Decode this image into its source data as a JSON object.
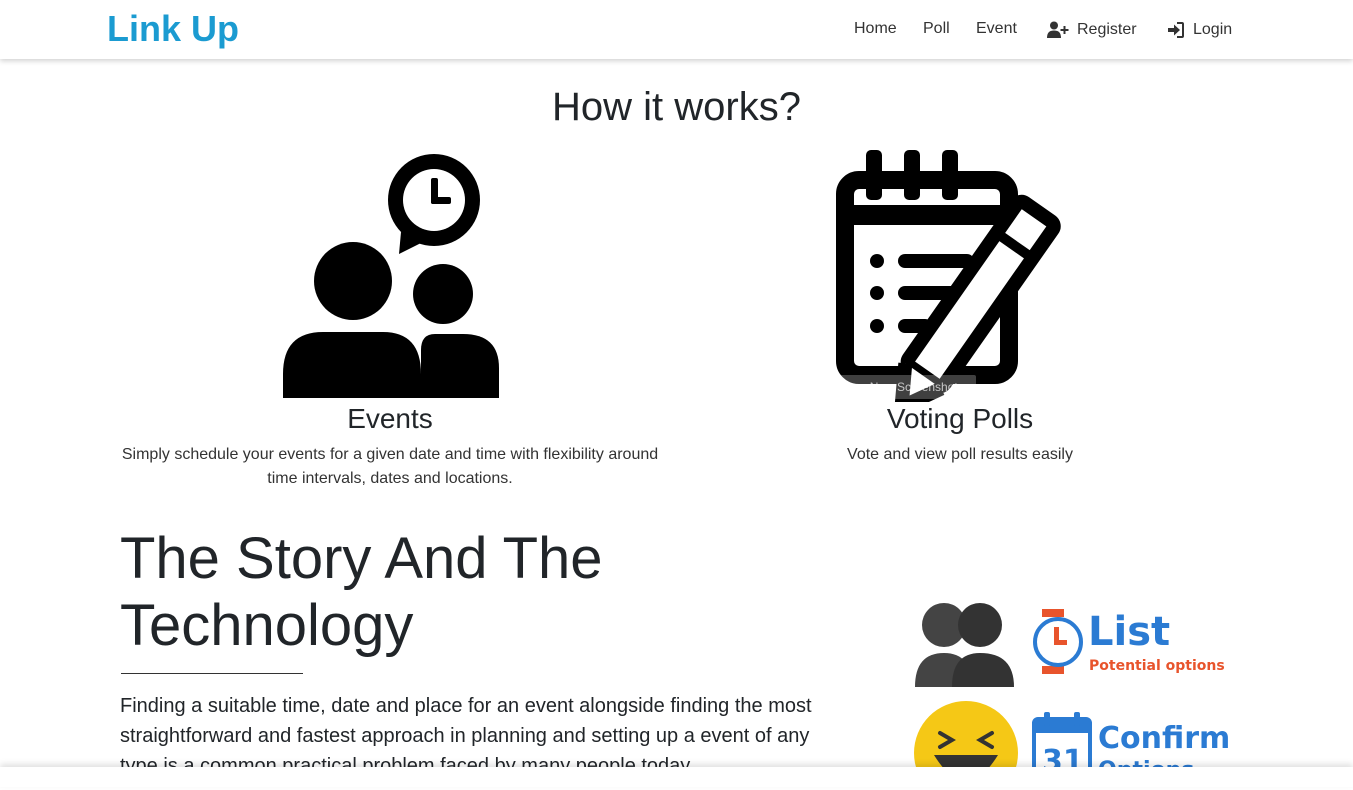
{
  "navbar": {
    "brand": "Link Up",
    "links": {
      "home": "Home",
      "poll": "Poll",
      "event": "Event",
      "register": "Register",
      "login": "Login"
    }
  },
  "how_it_works": {
    "title": "How it works?",
    "features": [
      {
        "title": "Events",
        "description": "Simply schedule your events for a given date and time with flexibility around time intervals, dates and locations.",
        "icon": "people-speech-clock-icon"
      },
      {
        "title": "Voting Polls",
        "description": "Vote and view poll results easily",
        "icon": "notepad-pencil-icon"
      }
    ],
    "overlay_text": "Take a New Screenshot"
  },
  "story": {
    "title": "The Story And The Technology",
    "text": "Finding a suitable time, date and place for an event alongside finding the most straightforward and fastest approach in planning and setting up a event of any type is a common practical problem faced by many people today.",
    "art": {
      "list_title": "List",
      "list_subtitle": "Potential options",
      "confirm_title": "Confirm",
      "confirm_subtitle": "Options",
      "calendar_day": "31"
    }
  },
  "colors": {
    "brand": "#1b9bd1",
    "art_blue": "#2b7bd3",
    "art_orange": "#e8542c",
    "emoji_yellow": "#f5c816"
  }
}
